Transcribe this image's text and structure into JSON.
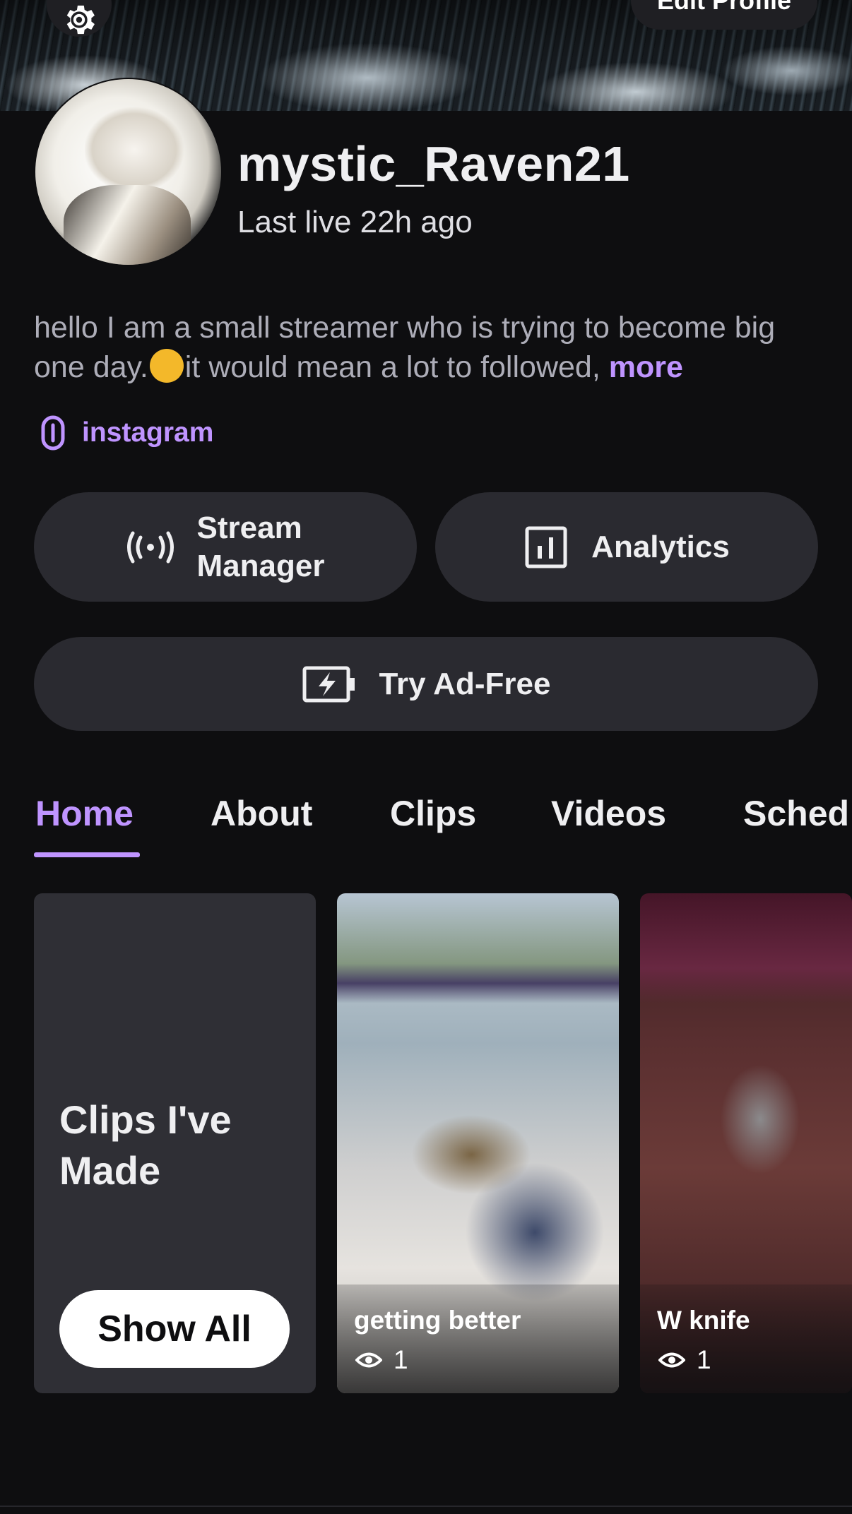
{
  "header": {
    "edit_profile_label": "Edit Profile"
  },
  "profile": {
    "username": "mystic_Raven21",
    "last_live": "Last live 22h ago",
    "bio_text": "hello I am a small streamer who is trying to become big one day.",
    "bio_text_after_emoji": "it would mean a lot to followed,",
    "bio_more": "more",
    "link_label": "instagram"
  },
  "actions": {
    "stream_manager_line1": "Stream",
    "stream_manager_line2": "Manager",
    "analytics_label": "Analytics",
    "ad_free_label": "Try Ad-Free"
  },
  "tabs": [
    {
      "label": "Home",
      "active": true
    },
    {
      "label": "About",
      "active": false
    },
    {
      "label": "Clips",
      "active": false
    },
    {
      "label": "Videos",
      "active": false
    },
    {
      "label": "Sched",
      "active": false
    }
  ],
  "clips_section": {
    "title": "Clips I've Made",
    "show_all_label": "Show All",
    "clips": [
      {
        "title": "getting better",
        "views": "1"
      },
      {
        "title": "W knife",
        "views": "1"
      }
    ]
  },
  "colors": {
    "accent": "#bf94ff",
    "background": "#0e0e10",
    "pill": "#2a2a30"
  },
  "icons": {
    "settings": "gear-icon",
    "link": "link-icon",
    "stream_manager": "broadcast-icon",
    "analytics": "bar-chart-icon",
    "ad_free": "battery-bolt-icon",
    "views": "eye-icon"
  }
}
